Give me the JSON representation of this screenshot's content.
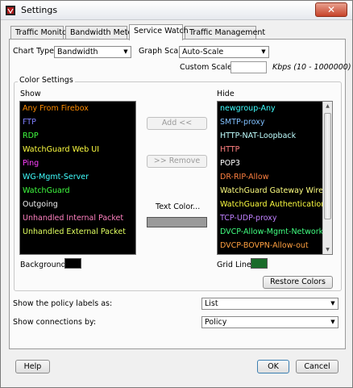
{
  "window": {
    "title": "Settings",
    "close_glyph": "✕"
  },
  "tabs": [
    {
      "label": "Traffic Monitor"
    },
    {
      "label": "Bandwidth Meter"
    },
    {
      "label": "Service Watch"
    },
    {
      "label": "Traffic Management"
    }
  ],
  "chart": {
    "type_label": "Chart Type",
    "type_value": "Bandwidth",
    "scale_label": "Graph Scale",
    "scale_value": "Auto-Scale",
    "custom_scale_label": "Custom Scale",
    "custom_scale_value": "",
    "units_hint": "Kbps (10 - 1000000)"
  },
  "color_settings": {
    "legend": "Color Settings",
    "show_label": "Show",
    "hide_label": "Hide",
    "show_items": [
      {
        "label": "Any From Firebox",
        "color": "#ff8c00"
      },
      {
        "label": "FTP",
        "color": "#8080ff"
      },
      {
        "label": "RDP",
        "color": "#40ff40"
      },
      {
        "label": "WatchGuard Web UI",
        "color": "#ffff40"
      },
      {
        "label": "Ping",
        "color": "#ff40ff"
      },
      {
        "label": "WG-Mgmt-Server",
        "color": "#40ffff"
      },
      {
        "label": "WatchGuard",
        "color": "#40ff40"
      },
      {
        "label": "Outgoing",
        "color": "#f0f0f0"
      },
      {
        "label": "Unhandled Internal Packet",
        "color": "#ff80c0"
      },
      {
        "label": "Unhandled External Packet",
        "color": "#e0ff60"
      }
    ],
    "hide_items": [
      {
        "label": "newgroup-Any",
        "color": "#40ffff"
      },
      {
        "label": "SMTP-proxy",
        "color": "#80c0ff"
      },
      {
        "label": "HTTP-NAT-Loopback",
        "color": "#c0ffff"
      },
      {
        "label": "HTTP",
        "color": "#ff8080"
      },
      {
        "label": "POP3",
        "color": "#ffffff"
      },
      {
        "label": "DR-RIP-Allow",
        "color": "#ff8040"
      },
      {
        "label": "WatchGuard Gateway Wireless",
        "color": "#ffff80"
      },
      {
        "label": "WatchGuard Authentication",
        "color": "#ffff40"
      },
      {
        "label": "TCP-UDP-proxy",
        "color": "#c080ff"
      },
      {
        "label": "DVCP-Allow-Mgmt-Network.in",
        "color": "#40ff80"
      },
      {
        "label": "DVCP-BOVPN-Allow-out",
        "color": "#ffa040"
      }
    ],
    "add_button": "Add <<",
    "remove_button": ">> Remove",
    "text_color_label": "Text Color...",
    "text_color_value": "#9a9a9a",
    "background_label": "Background",
    "background_color": "#000000",
    "grid_line_label": "Grid Line",
    "grid_line_color": "#1a6b2a",
    "restore_button": "Restore Colors"
  },
  "policy_labels": {
    "label": "Show the policy labels as:",
    "value": "List"
  },
  "connections": {
    "label": "Show connections by:",
    "value": "Policy"
  },
  "footer": {
    "help": "Help",
    "ok": "OK",
    "cancel": "Cancel"
  },
  "icons": {
    "combo_arrow": "▼",
    "scroll_up": "▲",
    "scroll_down": "▼"
  }
}
